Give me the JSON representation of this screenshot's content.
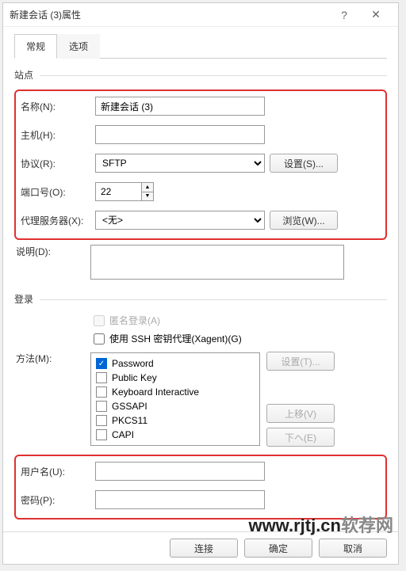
{
  "window": {
    "title": "新建会话 (3)属性",
    "help": "?",
    "close": "✕"
  },
  "tabs": {
    "general": "常规",
    "options": "选项"
  },
  "site": {
    "legend": "站点",
    "name_label": "名称(N):",
    "name_value": "新建会话 (3)",
    "host_label": "主机(H):",
    "host_value": "",
    "protocol_label": "协议(R):",
    "protocol_value": "SFTP",
    "settings_btn": "设置(S)...",
    "port_label": "端口号(O):",
    "port_value": "22",
    "proxy_label": "代理服务器(X):",
    "proxy_value": "<无>",
    "browse_btn": "浏览(W)...",
    "desc_label": "说明(D):",
    "desc_value": ""
  },
  "login": {
    "legend": "登录",
    "anon_label": "匿名登录(A)",
    "xagent_label": "使用 SSH 密钥代理(Xagent)(G)",
    "method_label": "方法(M):",
    "methods": {
      "password": "Password",
      "publickey": "Public Key",
      "keyboard": "Keyboard Interactive",
      "gssapi": "GSSAPI",
      "pkcs11": "PKCS11",
      "capi": "CAPI"
    },
    "settings_btn": "设置(T)...",
    "moveup_btn": "上移(V)",
    "movedown_btn": "下へ(E)",
    "user_label": "用户名(U):",
    "user_value": "",
    "pass_label": "密码(P):",
    "pass_value": ""
  },
  "footer": {
    "connect": "连接",
    "ok": "确定",
    "cancel": "取消"
  },
  "watermark": {
    "url": "www.rjtj.cn",
    "text": "软荐网"
  }
}
